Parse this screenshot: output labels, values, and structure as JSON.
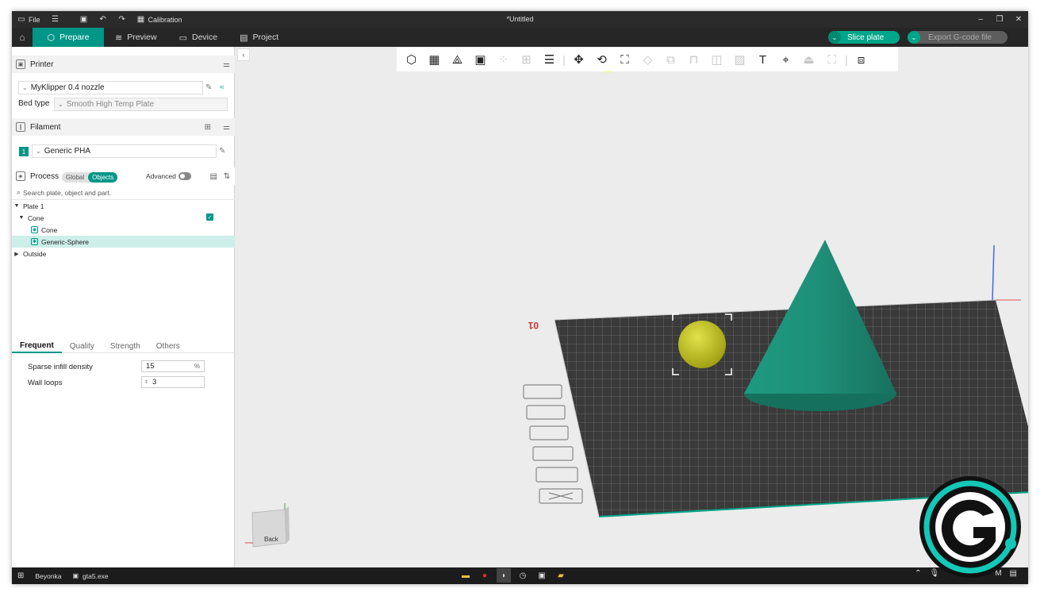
{
  "window": {
    "title": "*Untitled",
    "menu_file": "File",
    "calibration": "Calibration"
  },
  "tabs": [
    {
      "label": "Prepare",
      "active": true
    },
    {
      "label": "Preview",
      "active": false
    },
    {
      "label": "Device",
      "active": false
    },
    {
      "label": "Project",
      "active": false
    }
  ],
  "actions": {
    "slice": "Slice plate",
    "export": "Export G-code file"
  },
  "printer": {
    "header": "Printer",
    "name": "MyKlipper 0.4 nozzle",
    "bed_type_label": "Bed type",
    "bed_type": "Smooth High Temp Plate"
  },
  "filament": {
    "header": "Filament",
    "slot": "1",
    "name": "Generic PHA"
  },
  "process": {
    "header": "Process",
    "toggle_global": "Global",
    "toggle_objects": "Objects",
    "advanced": "Advanced",
    "search_placeholder": "Search plate, object and part."
  },
  "tree": {
    "plate": "Plate 1",
    "object": "Cone",
    "part1": "Cone",
    "part2": "Generic-Sphere",
    "outside": "Outside"
  },
  "param_tabs": [
    "Frequent",
    "Quality",
    "Strength",
    "Others"
  ],
  "params": {
    "infill_label": "Sparse infill density",
    "infill_value": "15",
    "infill_unit": "%",
    "wall_label": "Wall loops",
    "wall_value": "3"
  },
  "scene": {
    "plate_number": "01",
    "view_cube_label": "Back"
  },
  "taskbar": {
    "user": "Beyonka",
    "app": "gta5.exe",
    "time_fragment": "M"
  },
  "colors": {
    "accent": "#009688",
    "cone": "#1f8f7a",
    "sphere": "#c8c820",
    "bed": "#3a3a3a"
  }
}
